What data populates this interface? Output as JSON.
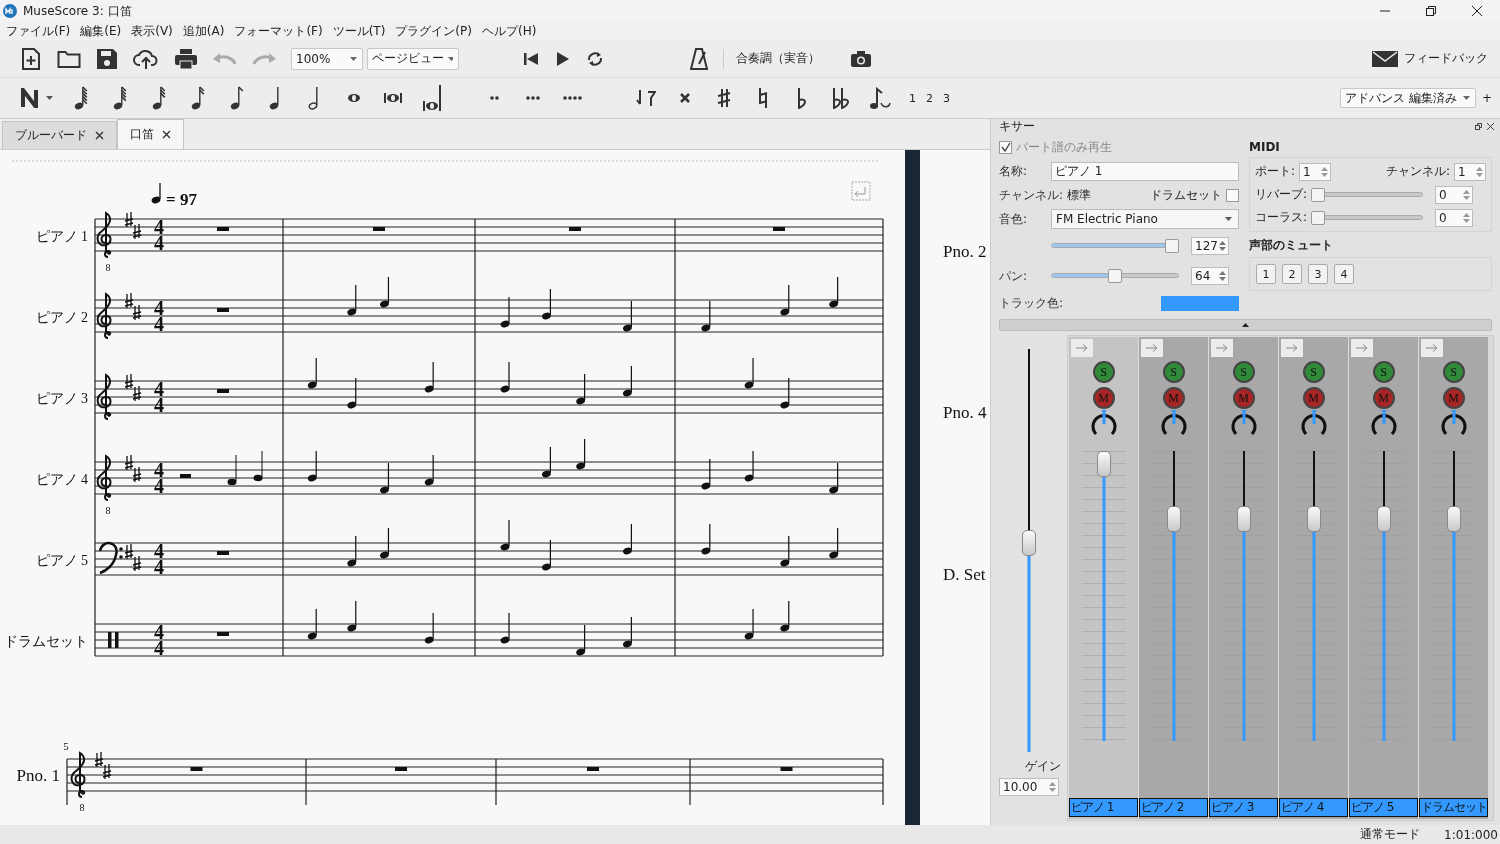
{
  "window": {
    "title": "MuseScore 3: 口笛"
  },
  "menu": [
    "ファイル(F)",
    "編集(E)",
    "表示(V)",
    "追加(A)",
    "フォーマット(F)",
    "ツール(T)",
    "プラグイン(P)",
    "ヘルプ(H)"
  ],
  "toolbar": {
    "zoom": "100%",
    "view_mode": "ページビュー",
    "concert_pitch": "合奏調（実音）",
    "feedback": "フィードバック"
  },
  "note_toolbar": {
    "voices": [
      "1",
      "2",
      "3"
    ],
    "workspace": "アドバンス 編集済み",
    "add": "+"
  },
  "tabs": [
    {
      "label": "ブルーバード",
      "selected": false
    },
    {
      "label": "口笛",
      "selected": true
    }
  ],
  "score": {
    "tempo": "= 97",
    "staves": [
      {
        "name": "ピアノ 1",
        "kind": "treble",
        "octave": "8",
        "time": [
          "4",
          "4"
        ]
      },
      {
        "name": "ピアノ 2",
        "kind": "treble",
        "time": [
          "4",
          "4"
        ]
      },
      {
        "name": "ピアノ 3",
        "kind": "treble",
        "time": [
          "4",
          "4"
        ]
      },
      {
        "name": "ピアノ 4",
        "kind": "treble",
        "octave": "8",
        "time": [
          "4",
          "4"
        ]
      },
      {
        "name": "ピアノ 5",
        "kind": "bass",
        "time": [
          "4",
          "4"
        ]
      },
      {
        "name": "ドラムセット",
        "kind": "percussion",
        "time": [
          "4",
          "4"
        ]
      }
    ],
    "second_system": {
      "measure_number": "5",
      "staves": [
        {
          "name": "Pno. 1",
          "kind": "treble",
          "octave": "8"
        }
      ]
    },
    "next_page_labels": [
      "Pno. 2",
      "Pno. 4",
      "D. Set"
    ]
  },
  "mixer": {
    "title": "キサー",
    "part_only": {
      "label": "パート譜のみ再生",
      "checked": true
    },
    "name": {
      "label": "名称:",
      "value": "ピアノ 1"
    },
    "channel": {
      "label": "チャンネル:",
      "value": "標準"
    },
    "drumset": {
      "label": "ドラムセット",
      "checked": false
    },
    "sound": {
      "label": "音色:",
      "value": "FM Electric Piano"
    },
    "volume": {
      "level": 1,
      "value": "127"
    },
    "pan": {
      "label": "パン:",
      "level": 0.5,
      "value": "64"
    },
    "track_color": {
      "label": "トラック色:",
      "color": "#3399ff"
    },
    "midi": {
      "title": "MIDI",
      "port": {
        "label": "ポート:",
        "value": "1"
      },
      "channel": {
        "label": "チャンネル:",
        "value": "1"
      },
      "reverb": {
        "label": "リバーブ:",
        "level": 0,
        "value": "0"
      },
      "chorus": {
        "label": "コーラス:",
        "level": 0,
        "value": "0"
      }
    },
    "voice_mute": {
      "title": "声部のミュート",
      "voices": [
        "1",
        "2",
        "3",
        "4"
      ]
    },
    "master": {
      "label": "ゲイン",
      "value": "10.00",
      "level": 0.52
    },
    "strips": [
      {
        "name": "ピアノ 1",
        "selected": true,
        "solo": "S",
        "mute": "M",
        "level": 1
      },
      {
        "name": "ピアノ 2",
        "selected": false,
        "solo": "S",
        "mute": "M",
        "level": 0.79
      },
      {
        "name": "ピアノ 3",
        "selected": false,
        "solo": "S",
        "mute": "M",
        "level": 0.79
      },
      {
        "name": "ピアノ 4",
        "selected": false,
        "solo": "S",
        "mute": "M",
        "level": 0.79
      },
      {
        "name": "ピアノ 5",
        "selected": false,
        "solo": "S",
        "mute": "M",
        "level": 0.79
      },
      {
        "name": "ドラムセット",
        "selected": false,
        "solo": "S",
        "mute": "M",
        "level": 0.79
      }
    ]
  },
  "status_bar": {
    "mode": "通常モード",
    "position": "1:01:000"
  }
}
